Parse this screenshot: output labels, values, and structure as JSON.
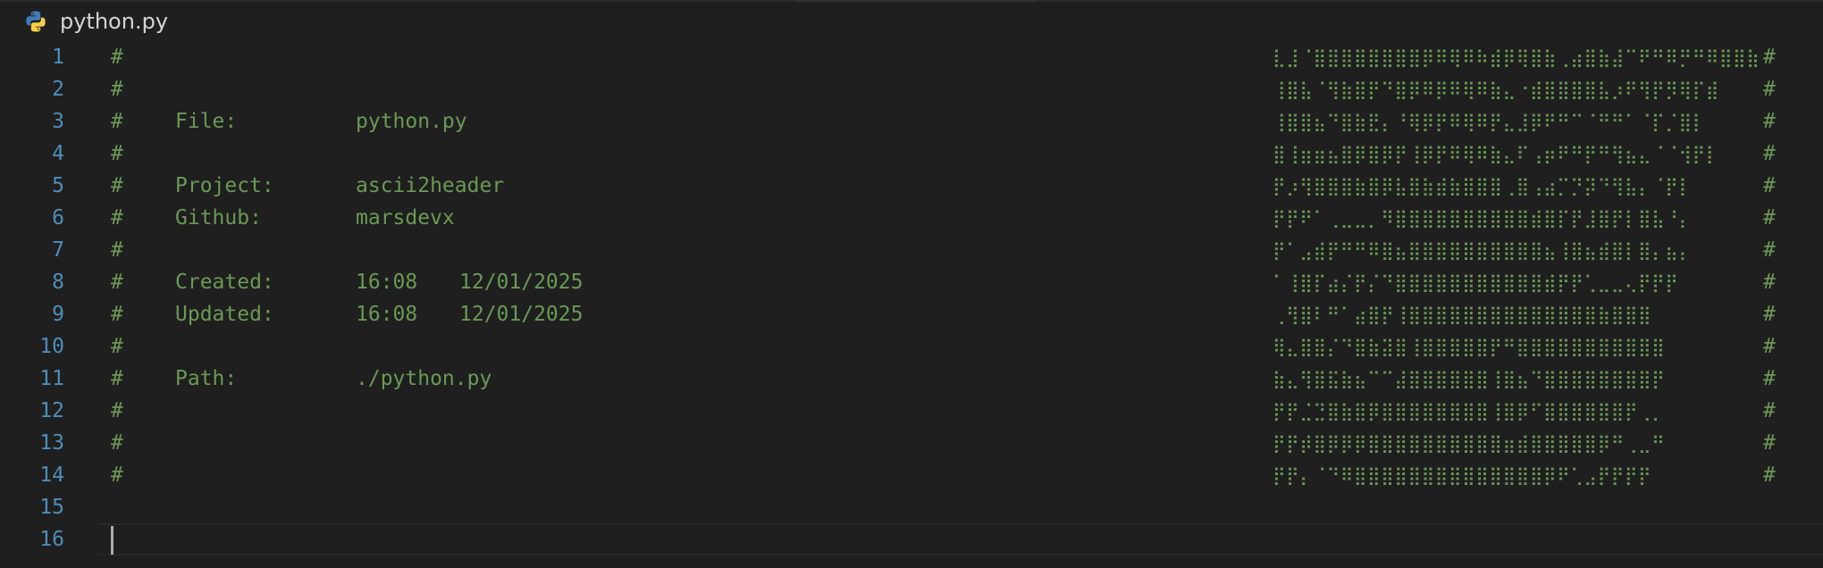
{
  "tab": {
    "filename": "python.py",
    "icon": "python-icon"
  },
  "colors": {
    "background": "#1f1f1f",
    "line_number": "#4e8db8",
    "comment": "#6a9955",
    "tab_text": "#d4d4d4"
  },
  "cursor_line": 16,
  "lines": [
    {
      "num": "1",
      "hash": "#",
      "key": "",
      "val": "",
      "val2": "",
      "art": "⣇⣸⠈⣿⣿⣿⣿⣿⣿⣿⣿⡿⠿⢿⠿⠷⣾⡿⢿⣿⣷⢀⣴⣿⣷⣼⠉⠟⠛⠿⡛⠛⠿⣿⣿⣷",
      "hash_r": "#"
    },
    {
      "num": "2",
      "hash": "#",
      "key": "",
      "val": "",
      "val2": "",
      "art": "⢸⣿⣧⠈⢻⣷⣿⡟⠙⣿⡿⠿⡿⠿⢿⠿⣷⣄⠐⣾⣿⣿⣿⣿⣧⡰⠟⢻⡟⡻⢿⡏⣾",
      "hash_r": "#"
    },
    {
      "num": "3",
      "hash": "#",
      "key": "File:",
      "val": "python.py",
      "val2": "",
      "art": "⢸⣿⣿⣦⠙⣿⣷⣟⡄⠘⢿⡿⡟⠿⢿⠿⡟⣄⣸⡿⠟⠛⠉⠈⠛⠛⠁⠈⡏⡈⣿⡇",
      "hash_r": "#"
    },
    {
      "num": "4",
      "hash": "#",
      "key": "",
      "val": "",
      "val2": "",
      "art": "⣿⢸⣶⣶⣦⣿⡿⣿⡿⡟⢸⡿⡟⠿⢿⠿⣷⣄⠏⢠⡶⠟⠛⡟⠛⢻⣦⣄⠈⠈⢺⡟⡇",
      "hash_r": "#"
    },
    {
      "num": "5",
      "hash": "#",
      "key": "Project:",
      "val": "ascii2header",
      "val2": "",
      "art": "⡟⡰⢻⣿⣿⣿⣷⣿⡿⣧⣿⣷⣾⣷⣿⣿⣿⢀⣿⢠⣴⡉⡙⡽⠙⢻⣧⡄⠈⡟⡇",
      "hash_r": "#"
    },
    {
      "num": "6",
      "hash": "#",
      "key": "Github:",
      "val": "marsdevx",
      "val2": "",
      "art": "⡟⡟⠟⠁⢀⣀⣀⡀⠻⣿⣿⣿⣿⣿⣿⣿⣿⣿⣿⣾⣿⡏⡟⣸⣿⡟⡇⣿⣧⠘⡄",
      "hash_r": "#"
    },
    {
      "num": "7",
      "hash": "#",
      "key": "",
      "val": "",
      "val2": "",
      "art": "⡟⠁⣠⣾⡟⠛⠛⠿⣿⣦⣿⣿⣿⣿⣿⣿⣿⣿⣿⣿⣦⢸⣿⣦⣾⣿⡇⣿⡄⣦⡄",
      "hash_r": "#"
    },
    {
      "num": "8",
      "hash": "#",
      "key": "Created:",
      "val": "16:08",
      "val2": "12/01/2025",
      "art": "⠁⢸⣿⡏⣴⡌⡟⡌⠙⣿⣿⣿⣿⣿⣿⣿⣿⣿⣿⣿⣾⡟⡟⢁⣀⣀⢄⡟⡟⡟",
      "hash_r": "#"
    },
    {
      "num": "9",
      "hash": "#",
      "key": "Updated:",
      "val": "16:08",
      "val2": "12/01/2025",
      "art": "⢀⢻⣿⠇⠛⠁⣴⣿⡟⢸⣿⣿⣿⣿⣿⣿⣿⣿⣿⣿⣿⣿⣿⣿⣷⣿⣿⣿",
      "hash_r": "#"
    },
    {
      "num": "10",
      "hash": "#",
      "key": "",
      "val": "",
      "val2": "",
      "art": "⢿⣄⣿⣿⡌⠙⣿⣷⣽⣿⢸⣿⣿⣿⣿⣿⡟⠛⣿⣿⣿⣿⣿⣿⣿⣿⣿⣿⣿",
      "hash_r": "#"
    },
    {
      "num": "11",
      "hash": "#",
      "key": "Path:",
      "val": "./python.py",
      "val2": "",
      "art": "⣷⣄⢻⣿⣯⣷⣦⠉⠉⣼⣿⣿⣿⣿⣿⣿⢸⣿⣦⠙⣿⣿⣿⣿⣿⣿⣿⣿⡟",
      "hash_r": "#"
    },
    {
      "num": "12",
      "hash": "#",
      "key": "",
      "val": "",
      "val2": "",
      "art": "⡟⡟⣈⣙⣿⣷⣿⡿⣿⣿⣿⣿⣿⣿⣿⣿⢸⣿⡿⠋⣿⣿⣿⣿⣿⣿⡟⢀⡀",
      "hash_r": "#"
    },
    {
      "num": "13",
      "hash": "#",
      "key": "",
      "val": "",
      "val2": "",
      "art": "⡟⡟⡾⣿⡿⡿⡿⣿⣿⣿⣿⣿⣿⣿⣿⣿⣿⣶⣾⣿⣿⣿⣿⣿⡿⠛⢀⣀⠛",
      "hash_r": "#"
    },
    {
      "num": "14",
      "hash": "#",
      "key": "",
      "val": "",
      "val2": "",
      "art": "⡟⡟⡄⠈⠙⠿⣿⣿⣿⣿⣿⣿⣿⣿⣿⣿⣿⣿⣿⣿⡿⠟⢁⣠⡟⡟⡟⡟",
      "hash_r": "#"
    },
    {
      "num": "15",
      "hash": "",
      "key": "",
      "val": "",
      "val2": "",
      "art": "",
      "hash_r": ""
    },
    {
      "num": "16",
      "hash": "",
      "key": "",
      "val": "",
      "val2": "",
      "art": "",
      "hash_r": ""
    }
  ]
}
